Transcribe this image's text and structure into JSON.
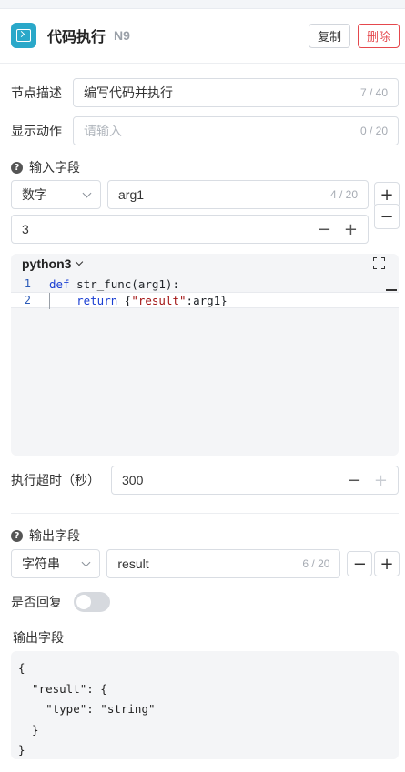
{
  "header": {
    "title": "代码执行",
    "node_id": "N9",
    "copy_label": "复制",
    "delete_label": "删除",
    "icon": "terminal-icon"
  },
  "node_desc": {
    "label": "节点描述",
    "value": "编写代码并执行",
    "count": "7 / 40"
  },
  "show_action": {
    "label": "显示动作",
    "placeholder": "请输入",
    "count": "0 / 20"
  },
  "input_section": {
    "title": "输入字段",
    "type_value": "数字",
    "name_value": "arg1",
    "name_count": "4 / 20",
    "number_value": "3",
    "add_label": "+",
    "remove_label": "−",
    "minus_label": "−",
    "plus_label": "+"
  },
  "editor": {
    "language": "python3",
    "lines": [
      {
        "num": "1",
        "kw": "def",
        "rest": " str_func(arg1):"
      },
      {
        "num": "2",
        "indent": "    ",
        "kw": "return",
        "brace_open": " {",
        "str": "\"result\"",
        "rest": ":arg1}"
      }
    ]
  },
  "timeout": {
    "label": "执行超时（秒）",
    "value": "300",
    "minus_label": "−",
    "plus_label": "+"
  },
  "output_section": {
    "title": "输出字段",
    "type_value": "字符串",
    "name_value": "result",
    "name_count": "6 / 20",
    "minus_label": "−",
    "plus_label": "+"
  },
  "reply": {
    "label": "是否回复",
    "enabled": false
  },
  "output_json": {
    "title": "输出字段",
    "lines": [
      "{",
      "  \"result\": {",
      "    \"type\": \"string\"",
      "  }",
      "}"
    ]
  },
  "colors": {
    "accent": "#2aa8c9",
    "danger": "#e5484d"
  }
}
